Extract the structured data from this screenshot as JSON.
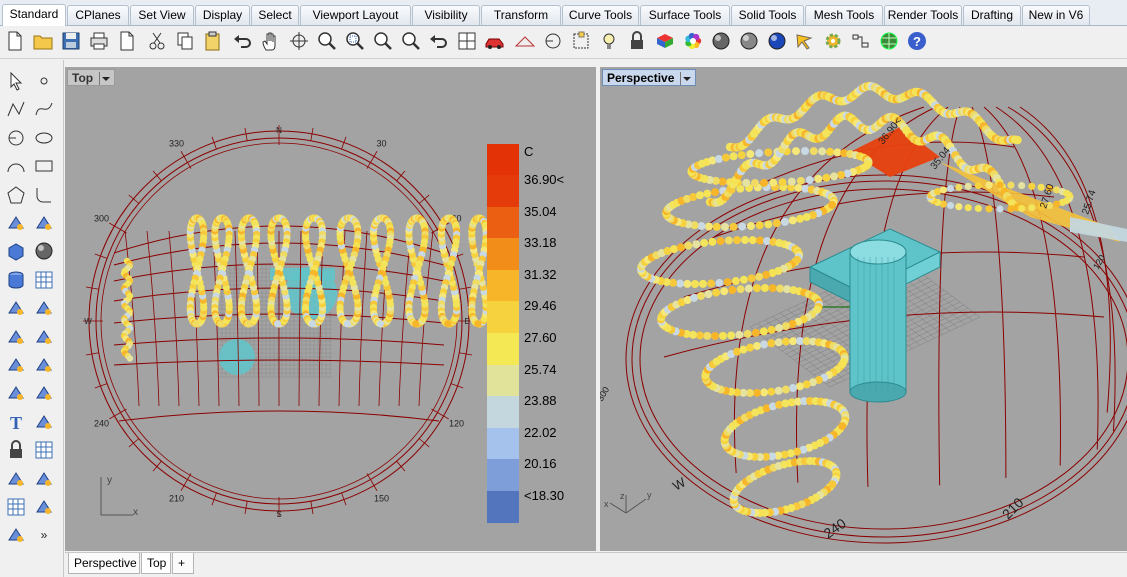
{
  "ribbon_tabs": [
    {
      "label": "Standard",
      "active": true
    },
    {
      "label": "CPlanes"
    },
    {
      "label": "Set View"
    },
    {
      "label": "Display"
    },
    {
      "label": "Select"
    },
    {
      "label": "Viewport Layout"
    },
    {
      "label": "Visibility"
    },
    {
      "label": "Transform"
    },
    {
      "label": "Curve Tools"
    },
    {
      "label": "Surface Tools"
    },
    {
      "label": "Solid Tools"
    },
    {
      "label": "Mesh Tools"
    },
    {
      "label": "Render Tools"
    },
    {
      "label": "Drafting"
    },
    {
      "label": "New in V6"
    }
  ],
  "toolbar_icons": [
    "new-file-icon",
    "open-folder-icon",
    "save-icon",
    "print-icon",
    "import-icon",
    "cut-icon",
    "copy-icon",
    "paste-icon",
    "undo-icon",
    "pan-hand-icon",
    "rotate-view-icon",
    "zoom-icon",
    "zoom-window-icon",
    "zoom-extents-icon",
    "zoom-selected-icon",
    "undo-view-icon",
    "four-viewports-icon",
    "car-icon",
    "plane-icon",
    "circle-icon",
    "layer-icon",
    "light-bulb-icon",
    "lock-icon",
    "material-icon",
    "color-wheel-icon",
    "shaded-sphere-icon",
    "rendered-sphere-icon",
    "blue-sphere-icon",
    "options-icon",
    "gear-icon",
    "grasshopper-icon",
    "globe-icon",
    "help-icon"
  ],
  "left_tool_icons": [
    "select-arrow-icon",
    "point-icon",
    "polyline-icon",
    "curve-icon",
    "circle-icon",
    "ellipse-icon",
    "arc-icon",
    "rectangle-icon",
    "polygon-icon",
    "fillet-icon",
    "free-form-icon",
    "surface-icon",
    "box-icon",
    "sphere-icon",
    "cylinder-icon",
    "mesh-icon",
    "boolean-icon",
    "extrude-icon",
    "transform-icon",
    "split-icon",
    "group-icon",
    "edit-point-icon",
    "join-icon",
    "offset-icon",
    "text-icon",
    "dimension-icon",
    "block-icon",
    "array-icon",
    "analyze-icon",
    "render-icon",
    "grid-icon",
    "control-point-icon",
    "cage-icon",
    "more-icon"
  ],
  "viewports": {
    "top": {
      "title": "Top",
      "compass": {
        "north": "N",
        "south": "S",
        "east": "E",
        "west": "W",
        "angles": [
          "330",
          "30",
          "300",
          "60",
          "240",
          "120",
          "210",
          "150"
        ]
      },
      "axes": {
        "x": "x",
        "y": "y"
      }
    },
    "perspective": {
      "title": "Perspective",
      "labels": [
        "36.90<",
        "35.04",
        "27.60",
        "25.74"
      ],
      "angles": [
        "W",
        "240",
        "210",
        "120",
        "300"
      ],
      "axes": {
        "x": "x",
        "y": "y",
        "z": "z"
      }
    }
  },
  "legend": {
    "unit": "C",
    "entries": [
      {
        "label": "36.90<",
        "color": "#e53b0a"
      },
      {
        "label": "35.04",
        "color": "#eb5f12"
      },
      {
        "label": "33.18",
        "color": "#f38d1a"
      },
      {
        "label": "31.32",
        "color": "#f7b52a"
      },
      {
        "label": "29.46",
        "color": "#f7d23f"
      },
      {
        "label": "27.60",
        "color": "#f5e855"
      },
      {
        "label": "25.74",
        "color": "#e2e39a"
      },
      {
        "label": "23.88",
        "color": "#c4d7df"
      },
      {
        "label": "22.02",
        "color": "#a5c2ed"
      },
      {
        "label": "20.16",
        "color": "#7d9ed8"
      },
      {
        "label": "<18.30",
        "color": "#5375bd"
      }
    ],
    "top_color": "#e23206"
  },
  "bottom_tabs": [
    {
      "label": "Perspective"
    },
    {
      "label": "Top",
      "selected": true
    },
    {
      "label": "+"
    }
  ],
  "colors": {
    "viewport_bg": "#a3a3a3",
    "sunpath_lines": "#8b0000",
    "building": "#63c4c9",
    "sun_path_base": "#f5e06a"
  }
}
